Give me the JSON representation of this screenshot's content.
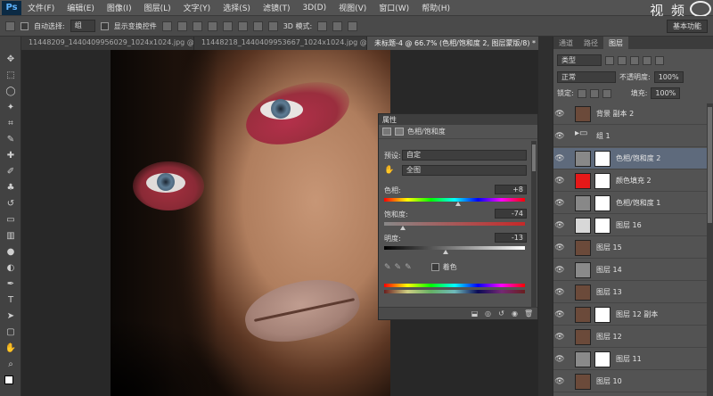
{
  "menubar": {
    "logo": "Ps",
    "items": [
      "文件(F)",
      "编辑(E)",
      "图像(I)",
      "图层(L)",
      "文字(Y)",
      "选择(S)",
      "滤镜(T)",
      "3D(D)",
      "视图(V)",
      "窗口(W)",
      "帮助(H)"
    ],
    "watermark": "视 频"
  },
  "options": {
    "auto_select_label": "自动选择:",
    "auto_select_value": "组",
    "show_transform_label": "显示变换控件",
    "mode_3d": "3D 模式:",
    "workspace": "基本功能"
  },
  "tabs": [
    {
      "label": "11448209_1440409956029_1024x1024.jpg @ 66.7..."
    },
    {
      "label": "11448218_1440409953667_1024x1024.jpg @ 66..."
    },
    {
      "label": "未标题-4 @ 66.7% (色相/饱和度 2, 图层蒙版/8) *"
    }
  ],
  "properties": {
    "title": "属性",
    "adjustment": "色相/饱和度",
    "preset_label": "预设:",
    "preset_value": "自定",
    "channel_value": "全图",
    "hue_label": "色相:",
    "hue_value": "+8",
    "saturation_label": "饱和度:",
    "saturation_value": "-74",
    "lightness_label": "明度:",
    "lightness_value": "-13",
    "colorize_label": "着色",
    "hue": 8,
    "saturation": -74,
    "lightness": -13
  },
  "layers": {
    "tabs": [
      "通道",
      "路径",
      "图层"
    ],
    "kind_label": "类型",
    "blend_mode": "正常",
    "opacity_label": "不透明度:",
    "opacity_value": "100%",
    "lock_label": "锁定:",
    "fill_label": "填充:",
    "fill_value": "100%",
    "items": [
      {
        "name": "背景 副本 2",
        "thumb": "#6b4a3a",
        "mask": false,
        "selected": false
      },
      {
        "name": "组 1",
        "thumb": "folder",
        "mask": false,
        "selected": false
      },
      {
        "name": "色相/饱和度 2",
        "thumb": "#888888",
        "mask": true,
        "selected": true
      },
      {
        "name": "颜色填充 2",
        "thumb": "#e61818",
        "mask": true,
        "selected": false
      },
      {
        "name": "色相/饱和度 1",
        "thumb": "#888888",
        "mask": true,
        "selected": false
      },
      {
        "name": "图层 16",
        "thumb": "#d8d8d8",
        "mask": true,
        "selected": false
      },
      {
        "name": "图层 15",
        "thumb": "#6b4a3a",
        "mask": false,
        "selected": false
      },
      {
        "name": "图层 14",
        "thumb": "#8a8a8a",
        "mask": false,
        "selected": false
      },
      {
        "name": "图层 13",
        "thumb": "#6b4a3a",
        "mask": false,
        "selected": false
      },
      {
        "name": "图层 12 副本",
        "thumb": "#6b4a3a",
        "mask": true,
        "selected": false
      },
      {
        "name": "图层 12",
        "thumb": "#6b4a3a",
        "mask": false,
        "selected": false
      },
      {
        "name": "图层 11",
        "thumb": "#8a8a8a",
        "mask": true,
        "selected": false
      },
      {
        "name": "图层 10",
        "thumb": "#6b4a3a",
        "mask": false,
        "selected": false
      }
    ]
  }
}
